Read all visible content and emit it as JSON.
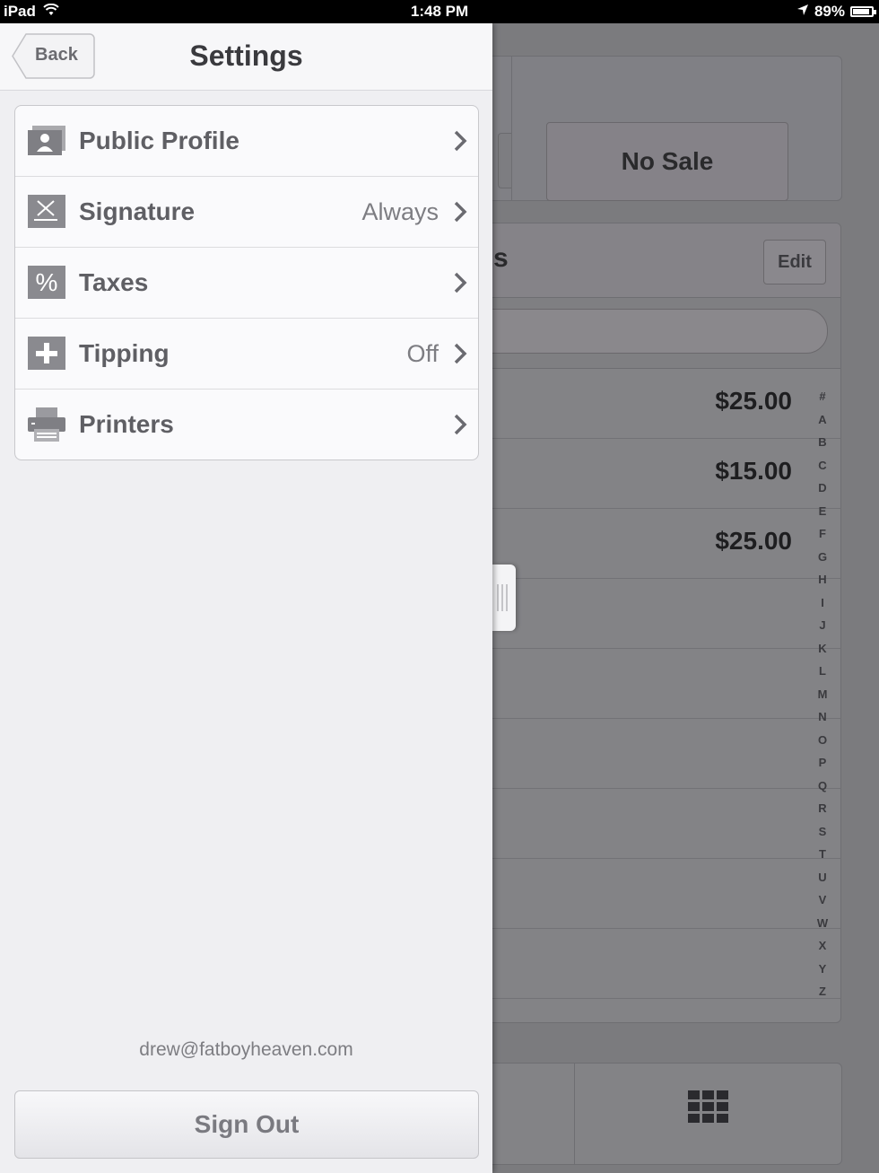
{
  "status_bar": {
    "device": "iPad",
    "time": "1:48 PM",
    "battery": "89%",
    "battery_level": 0.89
  },
  "settings": {
    "title": "Settings",
    "back_label": "Back",
    "items": [
      {
        "label": "Public Profile",
        "value": "",
        "icon": "profile-icon"
      },
      {
        "label": "Signature",
        "value": "Always",
        "icon": "signature-icon"
      },
      {
        "label": "Taxes",
        "value": "",
        "icon": "percent-icon"
      },
      {
        "label": "Tipping",
        "value": "Off",
        "icon": "plus-icon"
      },
      {
        "label": "Printers",
        "value": "",
        "icon": "printer-icon"
      }
    ],
    "account_email": "drew@fatboyheaven.com",
    "sign_out_label": "Sign Out"
  },
  "background": {
    "no_sale_label": "No Sale",
    "list_header_fragment": "s",
    "edit_label": "Edit",
    "prices": [
      "$25.00",
      "$15.00",
      "$25.00"
    ],
    "index_letters": [
      "#",
      "A",
      "B",
      "C",
      "D",
      "E",
      "F",
      "G",
      "H",
      "I",
      "J",
      "K",
      "L",
      "M",
      "N",
      "O",
      "P",
      "Q",
      "R",
      "S",
      "T",
      "U",
      "V",
      "W",
      "X",
      "Y",
      "Z"
    ]
  },
  "colors": {
    "panel_bg": "#efeff2",
    "overlay_bg": "#7b7b7e",
    "label_text": "#5f5f64"
  }
}
